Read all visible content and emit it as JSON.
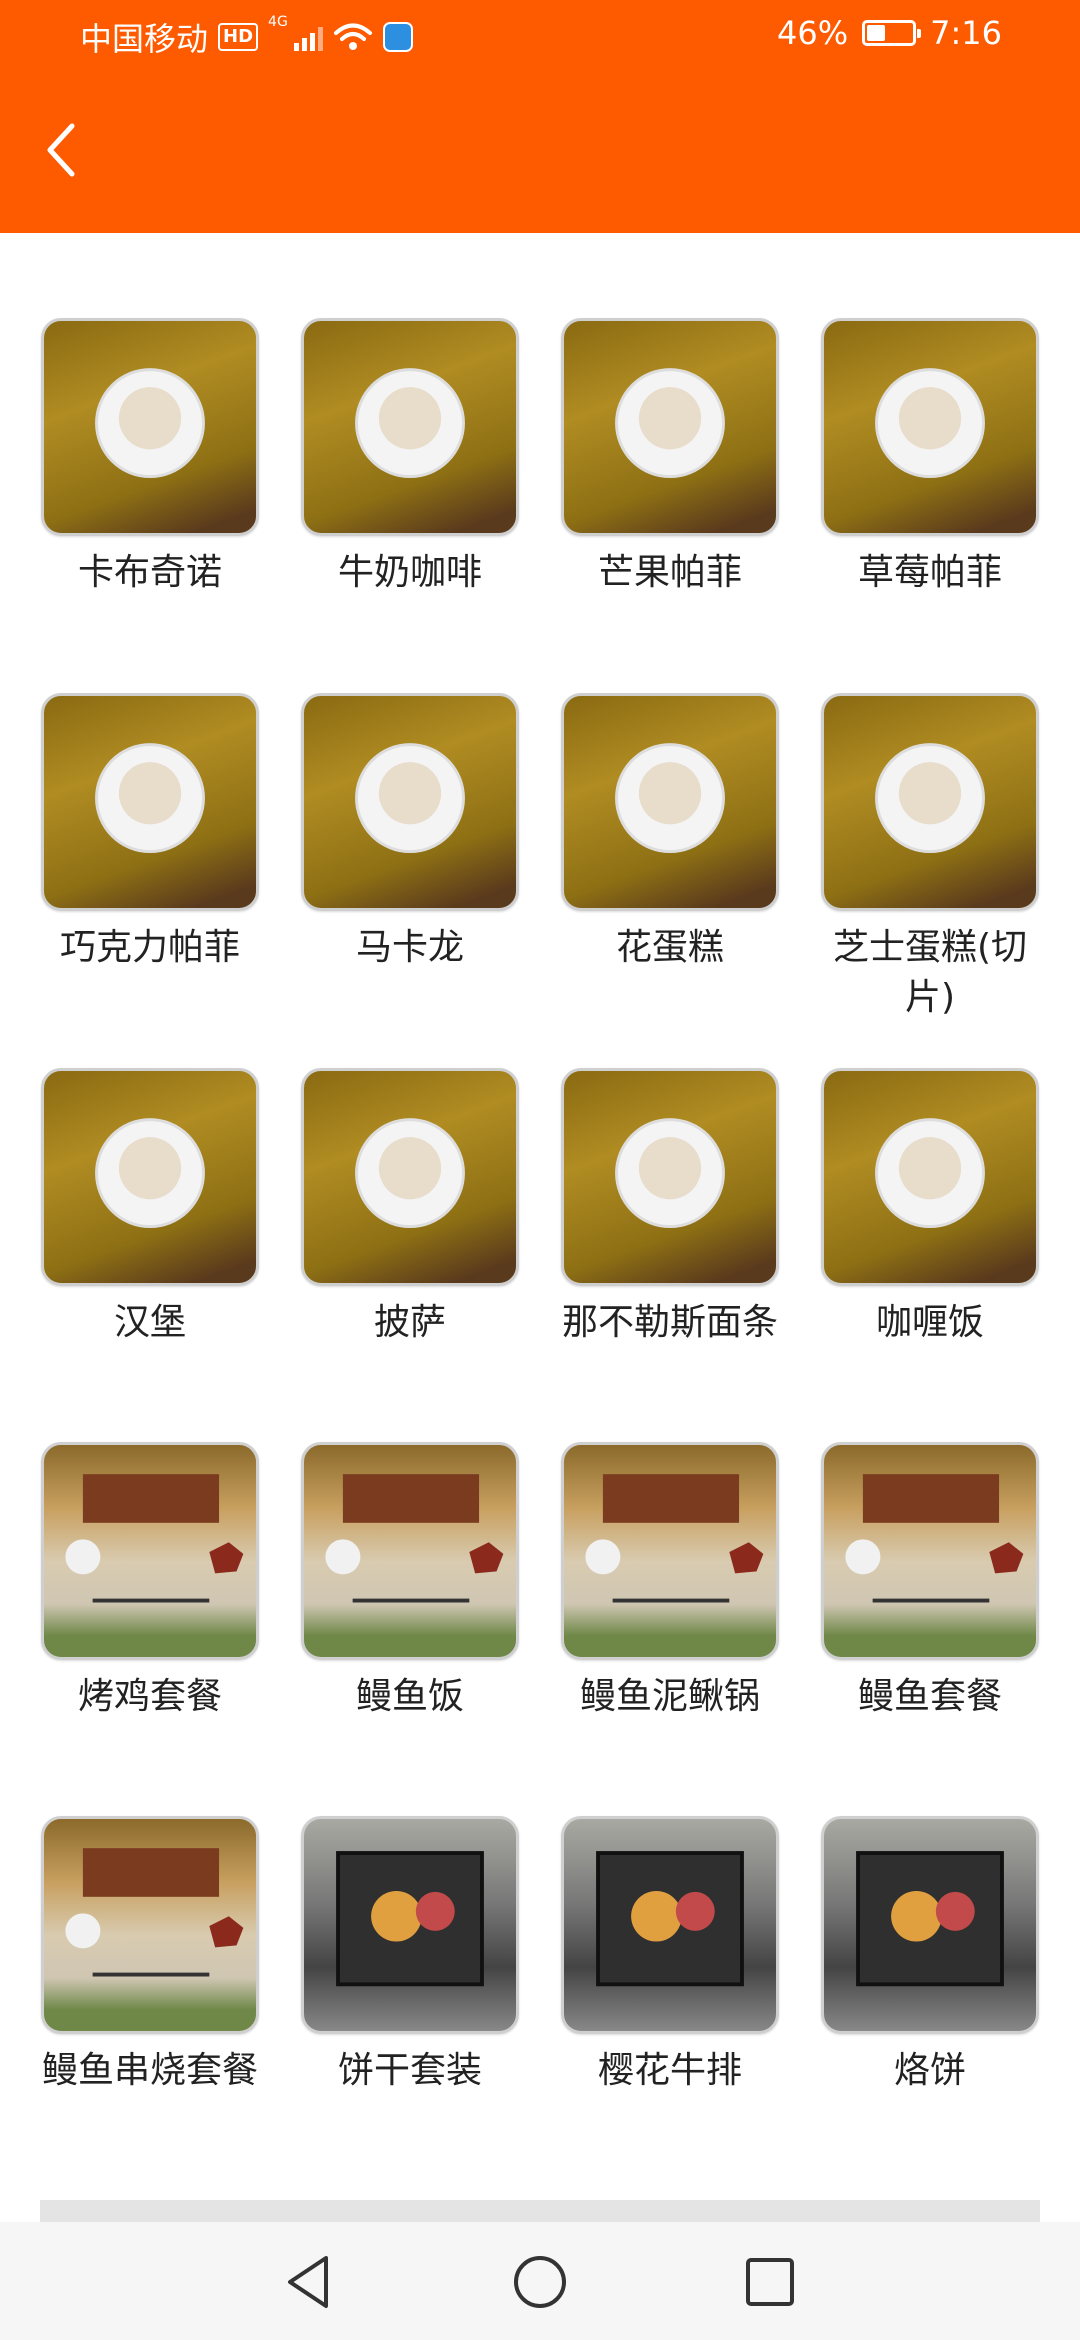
{
  "status_bar": {
    "carrier": "中国移动",
    "hd": "HD",
    "network": "4G",
    "battery_percent": "46%",
    "battery_level": 0.46,
    "time": "7:16",
    "icons": [
      "hd-icon",
      "signal-icon",
      "wifi-icon",
      "app-notification-icon",
      "battery-icon"
    ]
  },
  "header": {
    "back_icon": "chevron-left-icon"
  },
  "colors": {
    "header_bg": "#fe5a00",
    "text": "#222222",
    "page_bg": "#ffffff"
  },
  "items": [
    {
      "label": "卡布奇诺",
      "scene": "cafe"
    },
    {
      "label": "牛奶咖啡",
      "scene": "cafe"
    },
    {
      "label": "芒果帕菲",
      "scene": "cafe"
    },
    {
      "label": "草莓帕菲",
      "scene": "cafe"
    },
    {
      "label": "巧克力帕菲",
      "scene": "cafe"
    },
    {
      "label": "马卡龙",
      "scene": "cafe"
    },
    {
      "label": "花蛋糕",
      "scene": "cafe"
    },
    {
      "label": "芝士蛋糕(切片)",
      "scene": "cafe"
    },
    {
      "label": "汉堡",
      "scene": "cafe"
    },
    {
      "label": "披萨",
      "scene": "cafe"
    },
    {
      "label": "那不勒斯面条",
      "scene": "cafe"
    },
    {
      "label": "咖喱饭",
      "scene": "cafe"
    },
    {
      "label": "烤鸡套餐",
      "scene": "tatami"
    },
    {
      "label": "鳗鱼饭",
      "scene": "tatami"
    },
    {
      "label": "鳗鱼泥鳅锅",
      "scene": "tatami"
    },
    {
      "label": "鳗鱼套餐",
      "scene": "tatami"
    },
    {
      "label": "鳗鱼串烧套餐",
      "scene": "tatami"
    },
    {
      "label": "饼干套装",
      "scene": "tray"
    },
    {
      "label": "樱花牛排",
      "scene": "tray"
    },
    {
      "label": "烙饼",
      "scene": "tray"
    }
  ],
  "nav_bar": {
    "back": "nav-back-icon",
    "home": "nav-home-icon",
    "recents": "nav-recents-icon"
  }
}
